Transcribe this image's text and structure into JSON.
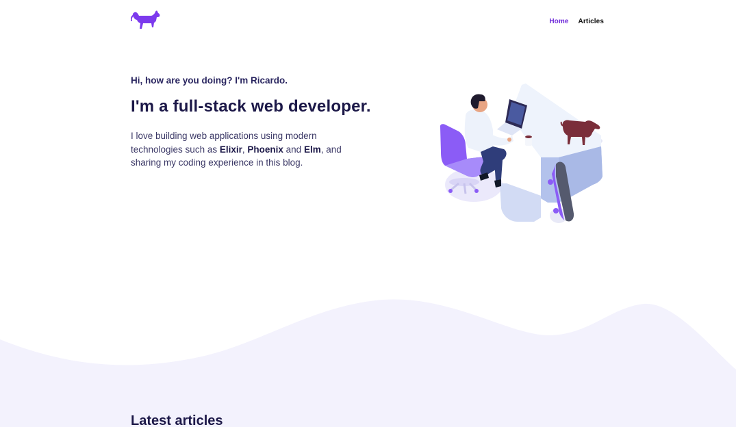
{
  "header": {
    "logo_icon": "dachshund-dog-icon",
    "brand_color": "#7c3aed",
    "nav": [
      {
        "label": "Home",
        "active": true
      },
      {
        "label": "Articles",
        "active": false
      }
    ]
  },
  "hero": {
    "greeting": "Hi, how are you doing? I'm Ricardo.",
    "title": "I'm a full-stack web developer.",
    "intro": {
      "part1": "I love building web applications using modern technologies such as ",
      "tech1": "Elixir",
      "sep1": ", ",
      "tech2": "Phoenix",
      "sep2": " and ",
      "tech3": "Elm",
      "part2": ", and sharing my coding experience in this blog."
    },
    "illustration_icon": "developer-at-desk-illustration"
  },
  "latest": {
    "heading": "Latest articles"
  },
  "colors": {
    "accent": "#6d28d9",
    "heading": "#1c1848",
    "wave_fill": "#f3f2fd"
  }
}
